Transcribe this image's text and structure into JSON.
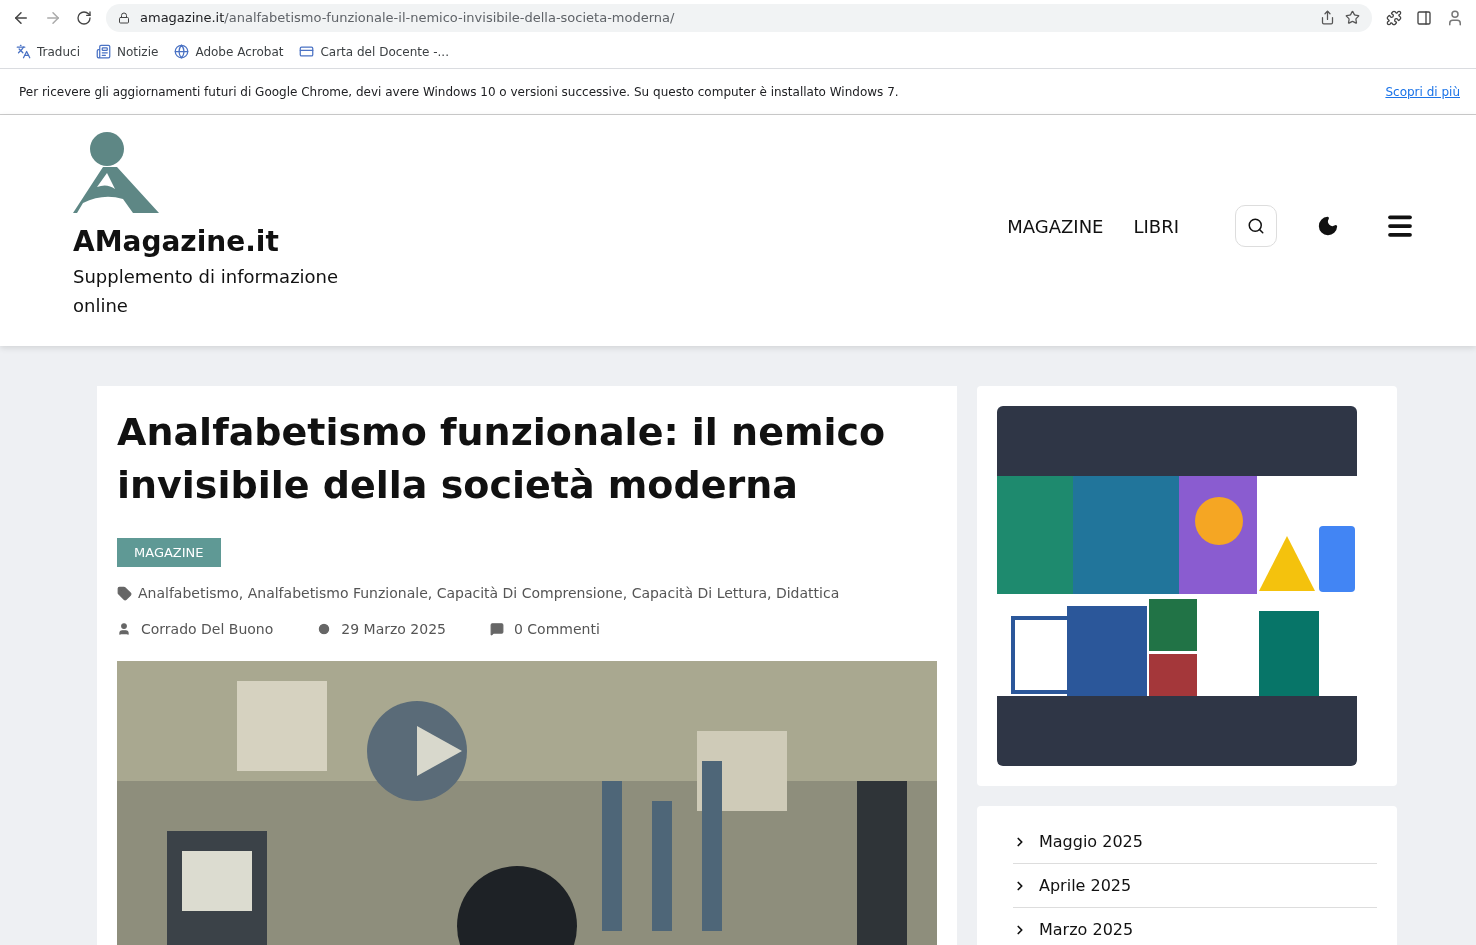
{
  "browser": {
    "url_host": "amagazine.it",
    "url_path": "/analfabetismo-funzionale-il-nemico-invisibile-della-societa-moderna/"
  },
  "bookmarks": [
    {
      "label": "Traduci",
      "kind": "translate"
    },
    {
      "label": "Notizie",
      "kind": "news"
    },
    {
      "label": "Adobe Acrobat",
      "kind": "globe"
    },
    {
      "label": "Carta del Docente -...",
      "kind": "card"
    }
  ],
  "infobar": {
    "message": "Per ricevere gli aggiornamenti futuri di Google Chrome, devi avere Windows 10 o versioni successive. Su questo computer è installato Windows 7.",
    "link": "Scopri di più"
  },
  "site": {
    "name": "AMagazine.it",
    "tagline": "Supplemento di informazione online",
    "nav": [
      "MAGAZINE",
      "LIBRI"
    ]
  },
  "article": {
    "title": "Analfabetismo funzionale: il nemico invisibile della società moderna",
    "category": "MAGAZINE",
    "tags": "Analfabetismo, Analfabetismo Funzionale, Capacità Di Comprensione, Capacità Di Lettura, Didattica",
    "author": "Corrado Del Buono",
    "date": "29 Marzo 2025",
    "comments": "0 Commenti",
    "image": {
      "kind": "picture"
    }
  },
  "sidebar": {
    "banner": {
      "kind": "picture"
    },
    "archive": [
      "Maggio 2025",
      "Aprile 2025",
      "Marzo 2025"
    ]
  }
}
